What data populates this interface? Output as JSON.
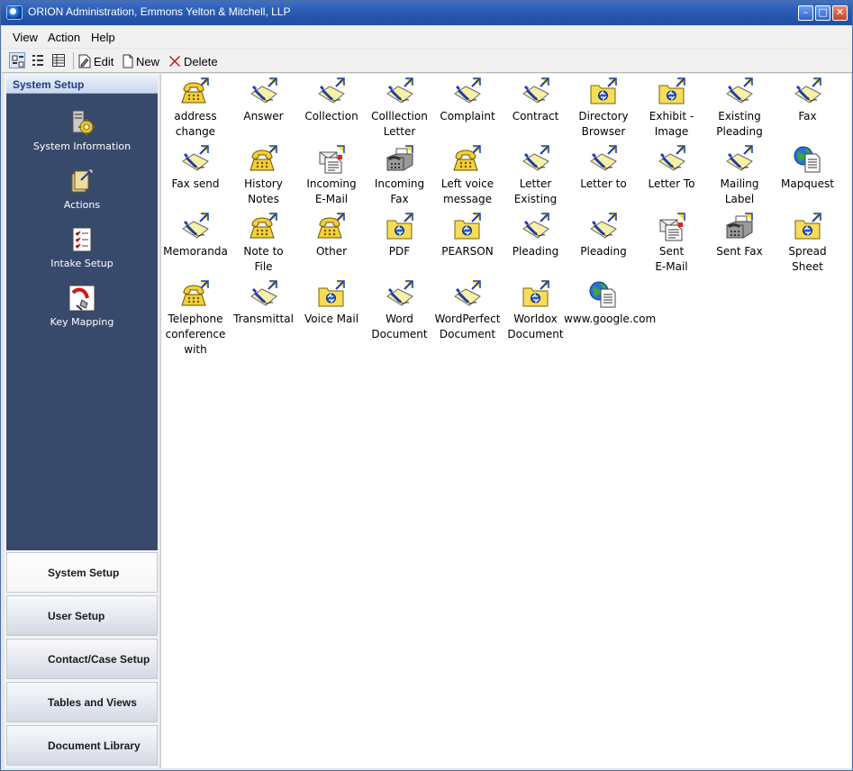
{
  "window": {
    "title": "ORION Administration, Emmons Yelton & Mitchell, LLP",
    "app_icon": "orion-logo-icon",
    "controls": [
      "minimize-icon",
      "maximize-icon",
      "close-icon"
    ]
  },
  "menubar": {
    "items": [
      "View",
      "Action",
      "Help"
    ]
  },
  "toolbar": {
    "view_buttons": [
      "large-icons-view-icon",
      "list-view-icon",
      "details-view-icon"
    ],
    "edit_label": "Edit",
    "new_label": "New",
    "delete_label": "Delete"
  },
  "sidebar": {
    "header": "System Setup",
    "items": [
      {
        "label": "System Information",
        "icon": "system-information-icon"
      },
      {
        "label": "Actions",
        "icon": "actions-icon"
      },
      {
        "label": "Intake Setup",
        "icon": "intake-setup-icon"
      },
      {
        "label": "Key Mapping",
        "icon": "key-mapping-icon"
      }
    ],
    "sections": [
      "System Setup",
      "User Setup",
      "Contact/Case Setup",
      "Tables and Views",
      "Document Library"
    ],
    "selected_section": "System Setup"
  },
  "main": {
    "items": [
      {
        "label": "address\nchange",
        "icon": "phone"
      },
      {
        "label": "Answer",
        "icon": "pen"
      },
      {
        "label": "Collection",
        "icon": "pen"
      },
      {
        "label": "Colllection\nLetter",
        "icon": "pen"
      },
      {
        "label": "Complaint",
        "icon": "pen"
      },
      {
        "label": "Contract",
        "icon": "pen"
      },
      {
        "label": "Directory\nBrowser",
        "icon": "folder"
      },
      {
        "label": "Exhibit -\nImage",
        "icon": "folder"
      },
      {
        "label": "Existing\nPleading",
        "icon": "pen"
      },
      {
        "label": "Fax",
        "icon": "pen"
      },
      {
        "label": "Fax send",
        "icon": "pen"
      },
      {
        "label": "History\nNotes",
        "icon": "phone"
      },
      {
        "label": "Incoming\nE-Mail",
        "icon": "email"
      },
      {
        "label": "Incoming\nFax",
        "icon": "fax"
      },
      {
        "label": "Left voice\nmessage",
        "icon": "phone"
      },
      {
        "label": "Letter\nExisting",
        "icon": "pen"
      },
      {
        "label": "Letter to",
        "icon": "pen"
      },
      {
        "label": "Letter To",
        "icon": "pen"
      },
      {
        "label": "Mailing\nLabel",
        "icon": "pen"
      },
      {
        "label": "Mapquest",
        "icon": "web"
      },
      {
        "label": "Memoranda",
        "icon": "pen"
      },
      {
        "label": "Note to\nFile",
        "icon": "phone"
      },
      {
        "label": "Other",
        "icon": "phone"
      },
      {
        "label": "PDF",
        "icon": "folder"
      },
      {
        "label": "PEARSON",
        "icon": "folder"
      },
      {
        "label": "Pleading",
        "icon": "pen"
      },
      {
        "label": "Pleading",
        "icon": "pen"
      },
      {
        "label": "Sent\nE-Mail",
        "icon": "email"
      },
      {
        "label": "Sent Fax",
        "icon": "fax"
      },
      {
        "label": "Spread\nSheet",
        "icon": "folder"
      },
      {
        "label": "Telephone\nconference\nwith",
        "icon": "phone"
      },
      {
        "label": "Transmittal",
        "icon": "pen"
      },
      {
        "label": "Voice Mail",
        "icon": "folder"
      },
      {
        "label": "Word\nDocument",
        "icon": "pen"
      },
      {
        "label": "WordPerfect\nDocument",
        "icon": "pen"
      },
      {
        "label": "Worldox\nDocument",
        "icon": "folder"
      },
      {
        "label": "www.google.com",
        "icon": "web"
      }
    ]
  },
  "colors": {
    "titlebar": "#2a5bb2",
    "sidebar_panel": "#384a6b",
    "sidebar_header_text": "#1c3e80",
    "phone_yellow": "#f3cf3a",
    "folder_yellow": "#f5dd58",
    "arrow_blue": "#1f3ea8"
  }
}
